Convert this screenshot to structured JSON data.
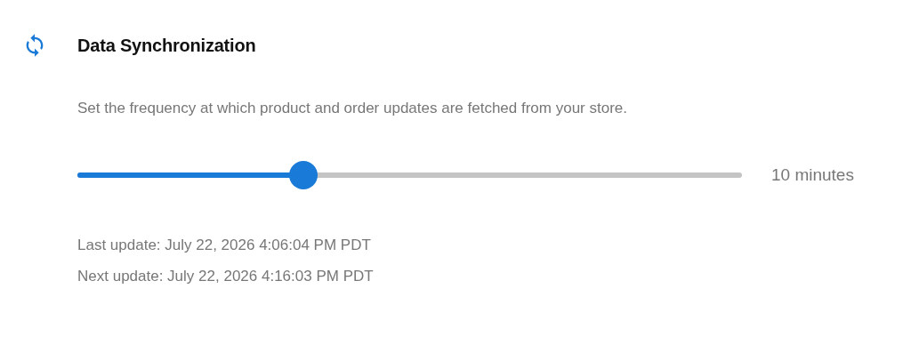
{
  "section": {
    "title": "Data Synchronization",
    "description": "Set the frequency at which product and order updates are fetched from your store."
  },
  "slider": {
    "level": 0.34,
    "reading": "10 minutes"
  },
  "updates": [
    "Last update: July 22, 2026 4:06:04 PM PDT",
    "Next update: July 22, 2026 4:16:03 PM PDT"
  ]
}
